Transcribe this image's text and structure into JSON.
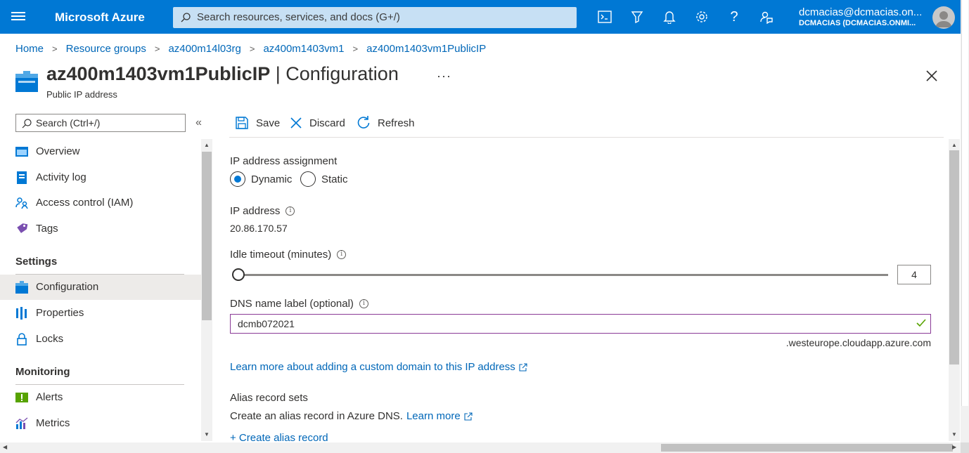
{
  "topbar": {
    "brand": "Microsoft Azure",
    "search_placeholder": "Search resources, services, and docs (G+/)",
    "user_email": "dcmacias@dcmacias.on...",
    "user_tenant": "DCMACIAS (DCMACIAS.ONMI..."
  },
  "breadcrumb": [
    "Home",
    "Resource groups",
    "az400m14l03rg",
    "az400m1403vm1",
    "az400m1403vm1PublicIP"
  ],
  "header": {
    "resource_name": "az400m1403vm1PublicIP",
    "blade_name": "| Configuration",
    "subtitle": "Public IP address",
    "more": "···"
  },
  "nav": {
    "search_placeholder": "Search (Ctrl+/)",
    "collapse": "«",
    "items_top": [
      {
        "label": "Overview",
        "icon": "overview-icon"
      },
      {
        "label": "Activity log",
        "icon": "activity-log-icon"
      },
      {
        "label": "Access control (IAM)",
        "icon": "iam-icon"
      },
      {
        "label": "Tags",
        "icon": "tag-icon"
      }
    ],
    "settings_heading": "Settings",
    "items_settings": [
      {
        "label": "Configuration",
        "icon": "configuration-icon",
        "active": true
      },
      {
        "label": "Properties",
        "icon": "properties-icon"
      },
      {
        "label": "Locks",
        "icon": "lock-icon"
      }
    ],
    "monitoring_heading": "Monitoring",
    "items_monitoring": [
      {
        "label": "Alerts",
        "icon": "alerts-icon"
      },
      {
        "label": "Metrics",
        "icon": "metrics-icon"
      }
    ]
  },
  "commands": {
    "save": "Save",
    "discard": "Discard",
    "refresh": "Refresh"
  },
  "form": {
    "assignment_label": "IP address assignment",
    "dynamic_label": "Dynamic",
    "static_label": "Static",
    "selected_assignment": "Dynamic",
    "ip_label": "IP address",
    "ip_value": "20.86.170.57",
    "idle_label": "Idle timeout (minutes)",
    "idle_value": "4",
    "dns_label": "DNS name label (optional)",
    "dns_value": "dcmb072021",
    "dns_suffix": ".westeurope.cloudapp.azure.com",
    "custom_domain_link": "Learn more about adding a custom domain to this IP address",
    "alias_heading": "Alias record sets",
    "alias_text": "Create an alias record in Azure DNS.",
    "alias_learn_more": "Learn more",
    "create_alias": "+ Create alias record"
  },
  "colors": {
    "accent": "#0078d4",
    "link": "#0067b8",
    "valid": "#57a300",
    "focus_border": "#8a3a96"
  }
}
